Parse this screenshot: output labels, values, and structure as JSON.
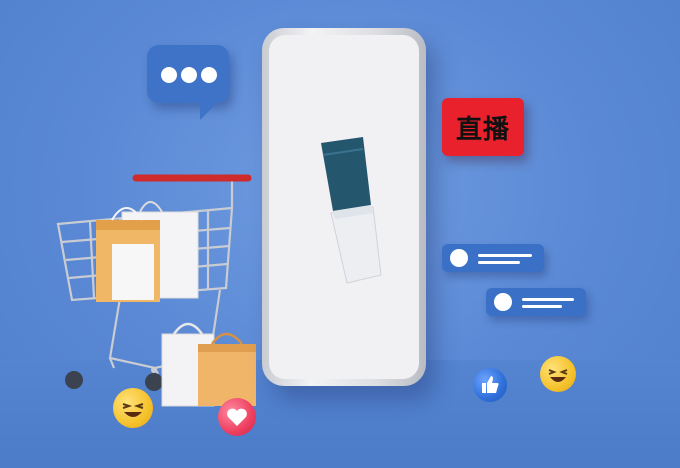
{
  "scene": {
    "live_sign": "直播",
    "colors": {
      "background": "#5a88d4",
      "bubble": "#3f73c8",
      "live_sign": "#e8212c",
      "bottle_cap": "#24566e",
      "emoji": "#f5c22b",
      "heart": "#ee3e5f",
      "like": "#2f6fd9"
    },
    "icons": [
      "chat-bubble-icon",
      "shopping-cart-icon",
      "shopping-bag-icon",
      "heart-icon",
      "thumbs-up-icon",
      "laughing-emoji-icon"
    ]
  }
}
